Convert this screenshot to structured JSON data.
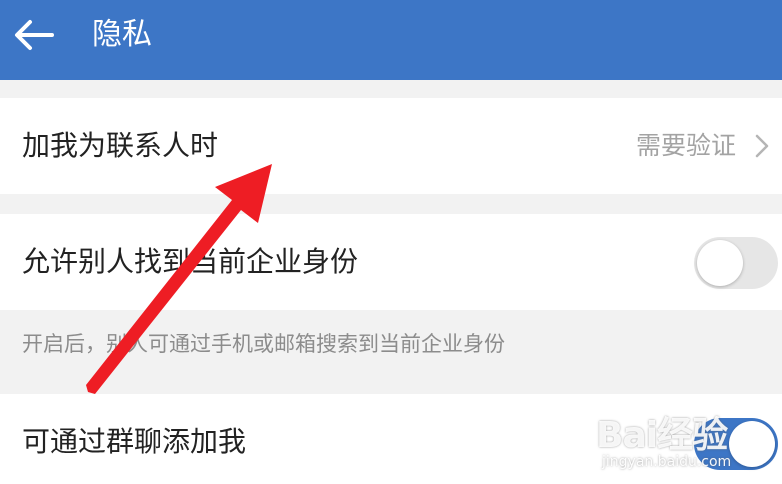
{
  "header": {
    "title": "隐私",
    "back_icon": "arrow-left-icon"
  },
  "rows": [
    {
      "label": "加我为联系人时",
      "value": "需要验证",
      "icon": "chevron-right-icon"
    },
    {
      "label": "允许别人找到当前企业身份",
      "toggle_on": false
    },
    {
      "label": "可通过群聊添加我",
      "toggle_on": true
    }
  ],
  "hint": "开启后，别人可通过手机或邮箱搜索到当前企业身份",
  "watermark": {
    "brand": "Bai经验",
    "url": "jingyan.baidu.com"
  },
  "colors": {
    "accent": "#3d76c6",
    "arrow": "#ee1d24",
    "toggle_off": "#e6e6e6"
  }
}
